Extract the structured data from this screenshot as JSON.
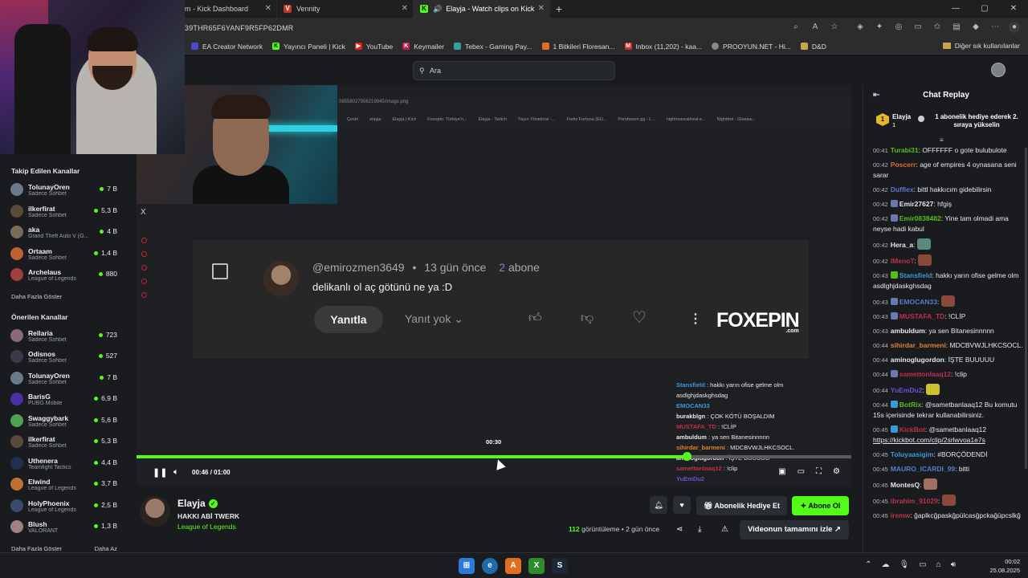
{
  "browser": {
    "tabs": [
      {
        "label": "m - Kick Dashboard",
        "icon": "kick-icon",
        "active": false
      },
      {
        "label": "Vennity",
        "icon": "vennity-icon",
        "active": false
      },
      {
        "label": "Elayja - Watch clips on Kick",
        "icon": "kick-icon",
        "active": true
      }
    ],
    "new_tab": "+",
    "url": "39THR65F6YANF9R5FP62DMR",
    "bookmarks": [
      {
        "label": "EA Creator Network",
        "color": "#4a4ad0"
      },
      {
        "label": "Yayıncı Paneli | Kick",
        "color": "#53fc18"
      },
      {
        "label": "YouTube",
        "color": "#e02020"
      },
      {
        "label": "Keymailer",
        "color": "#c02050"
      },
      {
        "label": "Tebex - Gaming Pay...",
        "color": "#30a0a0"
      },
      {
        "label": "1 Bitkileri Floresan...",
        "color": "#e07020"
      },
      {
        "label": "Inbox (11,202) - kaa...",
        "color": "#d03030"
      },
      {
        "label": "PROOYUN.NET - Hi...",
        "color": "#888888"
      },
      {
        "label": "D&D",
        "color": "#c9a54a"
      }
    ],
    "other_bookmarks": "Diğer sık kullanılanlar"
  },
  "topnav": {
    "search_placeholder": "Ara"
  },
  "sidebar": {
    "followed_title": "Takip Edilen Kanallar",
    "followed": [
      {
        "name": "TolunayOren",
        "category": "Sadece Sohbet",
        "viewers": "7 B",
        "color": "#6a7a8a"
      },
      {
        "name": "ilkerfirat",
        "category": "Sadece Sohbet",
        "viewers": "5,3 B",
        "color": "#5a4a3a"
      },
      {
        "name": "aka",
        "category": "Grand Theft Auto V (G...",
        "viewers": "4 B",
        "color": "#7a6a5a"
      },
      {
        "name": "Ortaam",
        "category": "Sadece Sohbet",
        "viewers": "1,4 B",
        "color": "#c06030"
      },
      {
        "name": "Archelaus",
        "category": "League of Legends",
        "viewers": "880",
        "color": "#a04040"
      }
    ],
    "followed_more": "Daha Fazla Göster",
    "recommended_title": "Önerilen Kanallar",
    "recommended": [
      {
        "name": "Rellaria",
        "category": "Sadece Sohbet",
        "viewers": "723",
        "color": "#8a6a7a"
      },
      {
        "name": "Odisnos",
        "category": "Sadece Sohbet",
        "viewers": "527",
        "color": "#3a3a4a"
      },
      {
        "name": "TolunayOren",
        "category": "Sadece Sohbet",
        "viewers": "7 B",
        "color": "#6a7a8a"
      },
      {
        "name": "BarisG",
        "category": "PUBG Mobile",
        "viewers": "6,9 B",
        "color": "#4a30a0"
      },
      {
        "name": "Swaggybark",
        "category": "Sadece Sohbet",
        "viewers": "5,6 B",
        "color": "#50a050"
      },
      {
        "name": "ilkerfirat",
        "category": "Sadece Sohbet",
        "viewers": "5,3 B",
        "color": "#5a4a3a"
      },
      {
        "name": "Uthenera",
        "category": "Teamfight Tactics",
        "viewers": "4,4 B",
        "color": "#203050"
      },
      {
        "name": "Elwind",
        "category": "League of Legends",
        "viewers": "3,7 B",
        "color": "#c07030"
      },
      {
        "name": "HolyPhoenix",
        "category": "League of Legends",
        "viewers": "2,5 B",
        "color": "#3a4a6a"
      },
      {
        "name": "Blush",
        "category": "VALORANT",
        "viewers": "1,3 B",
        "color": "#a08080"
      }
    ],
    "recommended_more": "Daha Fazla Göster",
    "recommended_less": "Daha Az"
  },
  "video": {
    "inner_url": "08558027956219945/image.png",
    "inner_bookmarks": [
      "Çeviri",
      "elayja",
      "Elayja | Kick",
      "Foxepin: Türkiye'n...",
      "Elayja - Twitch",
      "Yayın Yöneticisi -...",
      "Fortis Fortuna (EU...",
      "Porofessor.gg - L...",
      "nightmareai/real-e...",
      "Nightbot - Giveaw..."
    ],
    "close": "X",
    "comment": {
      "user": "@emirozmen3649",
      "sep": "•",
      "time": "13 gün önce",
      "sub_count": "2",
      "sub_label": "abone",
      "text": "delikanlı ol aç götünü ne ya :D",
      "reply": "Yanıtla",
      "replies": "Yanıt yok"
    },
    "logo_text": "FOXEPIN",
    "logo_sub": ".com",
    "overlay_chat": [
      {
        "user": "Stansfield",
        "text": "hakkı yarın ofise gelme olm",
        "color": "#3a9ad9"
      },
      {
        "user": "",
        "text": "asdlghjdaskghsdag",
        "color": "#e8e8e8"
      },
      {
        "user": "EMOCAN33",
        "text": "",
        "color": "#3a9ad9"
      },
      {
        "user": "burakblgn",
        "text": "ÇOK KÖTÜ BOŞALDIM",
        "color": "#e8e8e8"
      },
      {
        "user": "MUSTAFA_TD",
        "text": "!CLİP",
        "color": "#c0304a"
      },
      {
        "user": "ambuldum",
        "text": "ya sen Bitanesinnnnn",
        "color": "#e8e8e8"
      },
      {
        "user": "sihirdar_barmeni",
        "text": "MDCBVWJLHKCSOCL.",
        "color": "#e08030"
      },
      {
        "user": "aminoglugordon",
        "text": "İŞTE BUUUUU",
        "color": "#e8e8e8"
      },
      {
        "user": "samettonlaaq12",
        "text": "!clip",
        "color": "#c0304a"
      },
      {
        "user": "YuEmDu2",
        "text": "",
        "color": "#7050d0"
      }
    ],
    "time_bubble": "00:30",
    "current_time": "00:46",
    "duration": "01:00",
    "progress": 0.77,
    "hover": 0.5
  },
  "info": {
    "channel": "Elayja",
    "title": "HAKKI ABİ TWERK",
    "category": "League of Legends",
    "views": "112",
    "views_label": "görüntüleme",
    "age": "• 2 gün önce",
    "gift": "Abonelik Hediye Et",
    "follow": "Abone Ol",
    "full_video": "Videonun tamamını izle"
  },
  "chat": {
    "title": "Chat Replay",
    "pinned": {
      "user": "Elayja",
      "count": "1",
      "text": "1 abonelik hediye ederek 2. sıraya yükselin"
    },
    "messages": [
      {
        "ts": "00:41",
        "user": "Turabi31",
        "color": "#53c018",
        "text": "OFFFFFF o gote bulubulote",
        "badge": ""
      },
      {
        "ts": "00:42",
        "user": "Poscerr",
        "color": "#e06a30",
        "text": "age of empires 4 oynasana seni sarar",
        "badge": ""
      },
      {
        "ts": "00:42",
        "user": "Dufflex",
        "color": "#5a7ad0",
        "text": "bittl hakkıcım gidebilirsin",
        "badge": ""
      },
      {
        "ts": "00:42",
        "user": "Emir27627",
        "color": "#e8e8e8",
        "text": "hfgiş",
        "badge": "#6a7ab0"
      },
      {
        "ts": "00:42",
        "user": "Emir0838482",
        "color": "#53c018",
        "text": "Yine tam olmadi ama neyse hadi kabul",
        "badge": "#6a7ab0"
      },
      {
        "ts": "00:42",
        "user": "Hera_a",
        "color": "#e8e8e8",
        "text": "",
        "badge": "",
        "emote": "#5a8a7a"
      },
      {
        "ts": "00:42",
        "user": "IMenoT",
        "color": "#c0304a",
        "text": "",
        "badge": "",
        "emote": "#8a4a3a"
      },
      {
        "ts": "00:43",
        "user": "Stansfield",
        "color": "#3a9ad9",
        "text": "hakkı yarın ofise gelme olm asdlghjdaskghsdag",
        "badge": "#53c018"
      },
      {
        "ts": "00:43",
        "user": "EMOCAN33",
        "color": "#5a7ad0",
        "text": "",
        "badge": "#6a7ab0",
        "emote": "#8a4a3a"
      },
      {
        "ts": "00:43",
        "user": "MUSTAFA_TD",
        "color": "#c0304a",
        "text": "!CLİP",
        "badge": "#6a7ab0"
      },
      {
        "ts": "00:43",
        "user": "ambuldum",
        "color": "#e8e8e8",
        "text": "ya sen Bitanesinnnnn",
        "badge": ""
      },
      {
        "ts": "00:44",
        "user": "sihirdar_barmeni",
        "color": "#e08030",
        "text": "MDCBVWJLHKCSOCL.",
        "badge": ""
      },
      {
        "ts": "00:44",
        "user": "aminoglugordon",
        "color": "#e8e8e8",
        "text": "İŞTE BUUUUU",
        "badge": ""
      },
      {
        "ts": "00:44",
        "user": "samettonlaaq12",
        "color": "#c0304a",
        "text": "!clip",
        "badge": "#6a7ab0"
      },
      {
        "ts": "00:44",
        "user": "YuEmDu2",
        "color": "#7050d0",
        "text": "",
        "badge": "",
        "emote": "#d0c030"
      },
      {
        "ts": "00:44",
        "user": "BotRix",
        "color": "#53c018",
        "text": "@sametbanlaaq12 Bu komutu 15s içerisinde tekrar kullanabilirsiniz.",
        "badge": "#3a9ad9"
      },
      {
        "ts": "00:45",
        "user": "KickBot",
        "color": "#c0304a",
        "text": "@sametbanlaaq12",
        "badge": "#3a9ad9",
        "link": "https://kickbot.com/clip/2srlwvoa1e7s"
      },
      {
        "ts": "00:45",
        "user": "Toluyaasigim",
        "color": "#3a9ad9",
        "text": "#BORÇÖDENDİ",
        "badge": ""
      },
      {
        "ts": "00:45",
        "user": "MAURO_ICARDI_99",
        "color": "#5a7ad0",
        "text": "bitti",
        "badge": ""
      },
      {
        "ts": "00:45",
        "user": "MontesQ",
        "color": "#e8e8e8",
        "text": "",
        "badge": "",
        "emote": "#a07060"
      },
      {
        "ts": "00:45",
        "user": "ibrahim_91029",
        "color": "#c0304a",
        "text": "",
        "badge": "",
        "emote": "#8a4a3a"
      },
      {
        "ts": "00:45",
        "user": "iremw",
        "color": "#c0304a",
        "text": "ğaplkcğpaskğpülcasğpckağüpcslkğ",
        "badge": ""
      }
    ]
  },
  "taskbar": {
    "time": "00:02",
    "date": "25.08.2025"
  },
  "colors": {
    "accent": "#53fc18"
  }
}
